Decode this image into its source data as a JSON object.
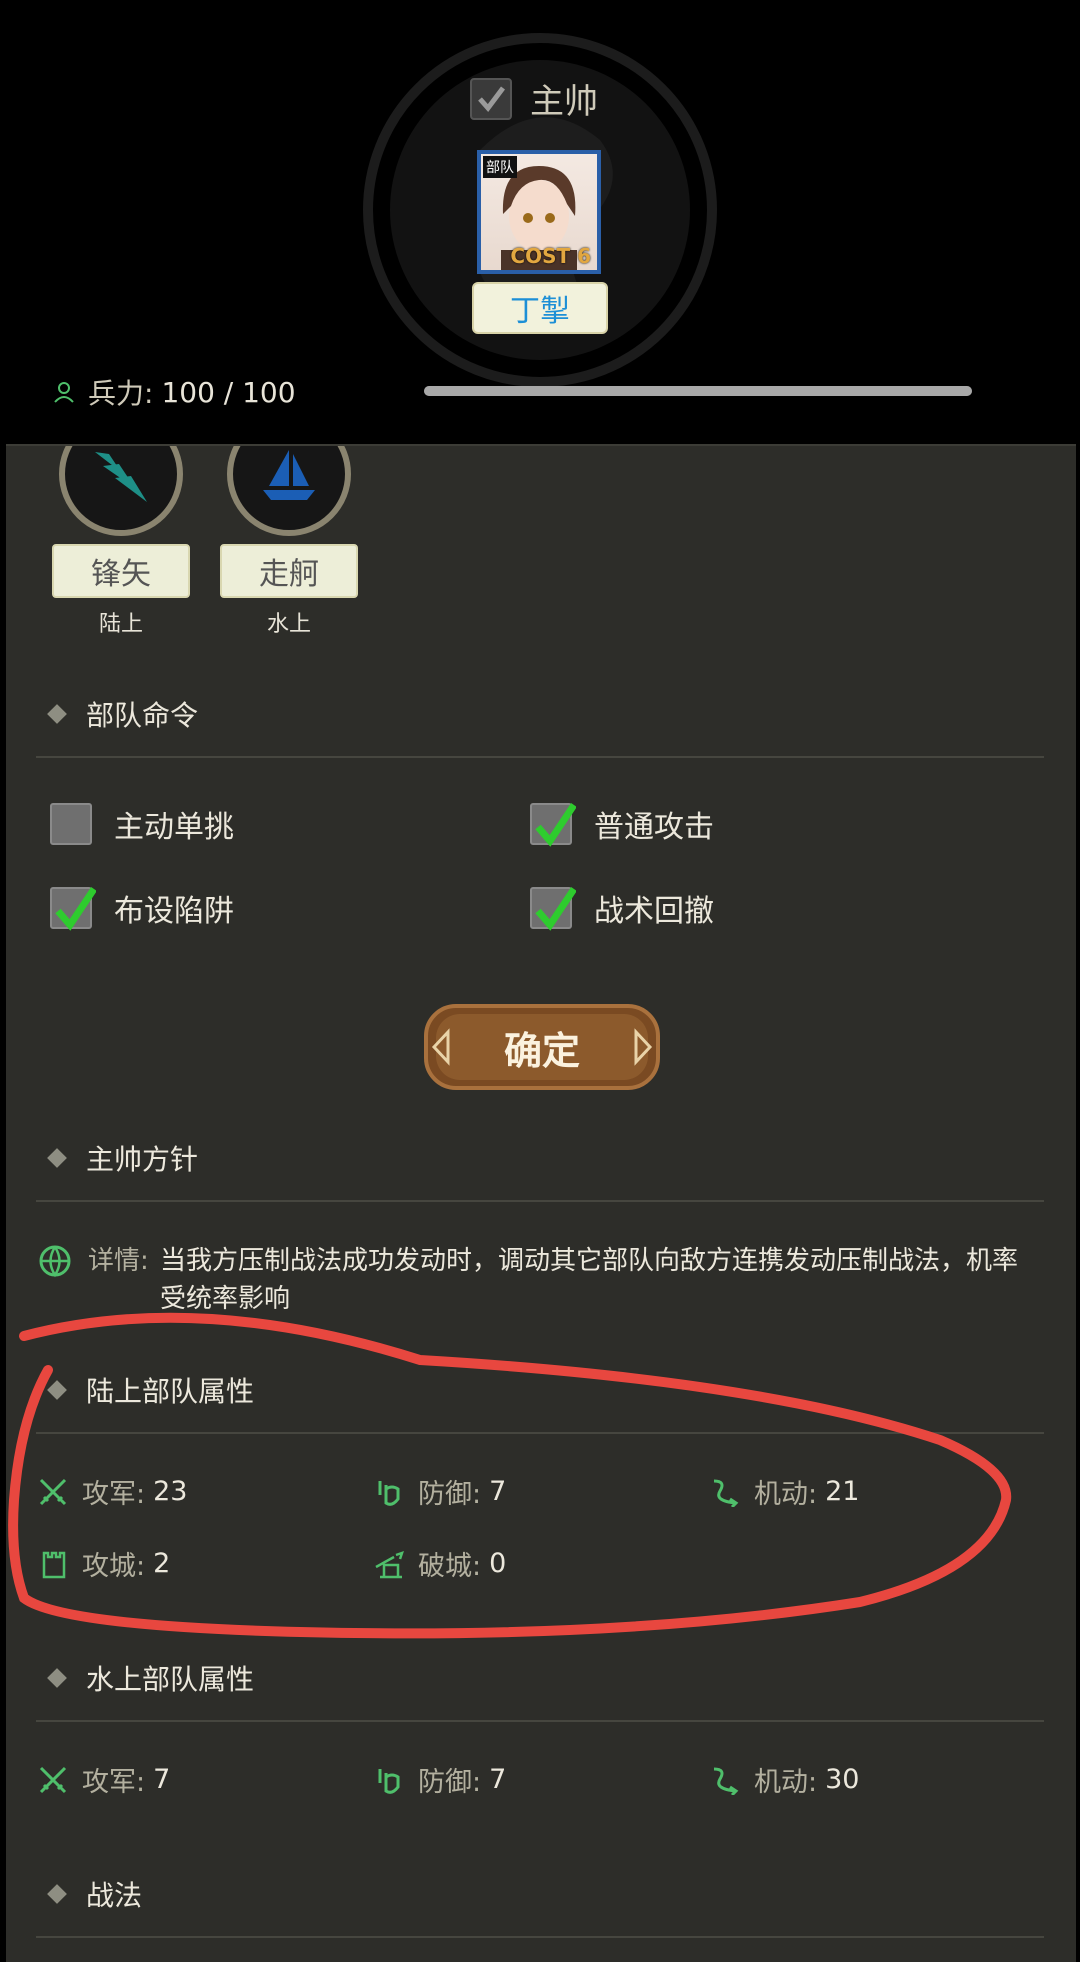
{
  "header": {
    "commander_label": "主帅",
    "portrait_tag": "部队",
    "portrait_cost": "COST 6",
    "general_name": "丁掣",
    "troops_label": "兵力:",
    "troops_value": "100 / 100",
    "troops_fraction": 1.0
  },
  "units": [
    {
      "name": "锋矢",
      "terrain": "陆上",
      "icon": "arrow-chevron-icon"
    },
    {
      "name": "走舸",
      "terrain": "水上",
      "icon": "sailboat-icon"
    }
  ],
  "orders": {
    "title": "部队命令",
    "options": [
      {
        "label": "主动单挑",
        "checked": false
      },
      {
        "label": "普通攻击",
        "checked": true
      },
      {
        "label": "布设陷阱",
        "checked": true
      },
      {
        "label": "战术回撤",
        "checked": true
      }
    ],
    "confirm_label": "确定"
  },
  "policy": {
    "title": "主帅方针",
    "detail_label": "详情:",
    "detail_text": "当我方压制战法成功发动时，调动其它部队向敌方连携发动压制战法，机率受统率影响"
  },
  "land_stats": {
    "title": "陆上部队属性",
    "attack_label": "攻军:",
    "attack_value": "23",
    "defense_label": "防御:",
    "defense_value": "7",
    "mobility_label": "机动:",
    "mobility_value": "21",
    "siege_label": "攻城:",
    "siege_value": "2",
    "breach_label": "破城:",
    "breach_value": "0"
  },
  "water_stats": {
    "title": "水上部队属性",
    "attack_label": "攻军:",
    "attack_value": "7",
    "defense_label": "防御:",
    "defense_value": "7",
    "mobility_label": "机动:",
    "mobility_value": "30"
  },
  "tactics": {
    "title": "战法"
  },
  "colors": {
    "accent_green": "#2ecc2e",
    "annotation_red": "#e8473f",
    "name_blue": "#1c8fd6"
  }
}
